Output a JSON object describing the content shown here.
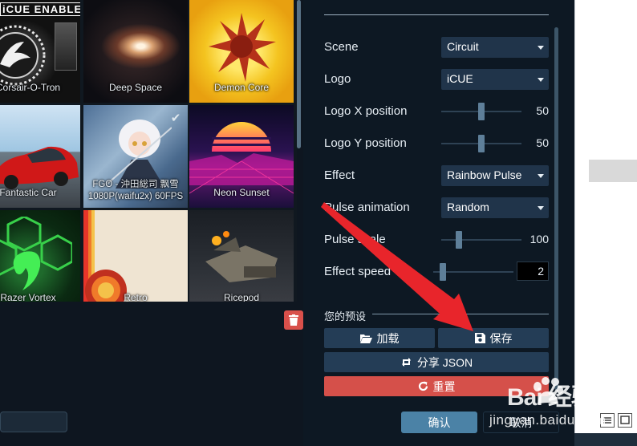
{
  "wallpapers": [
    {
      "label": "Corsair-O-Tron",
      "badge": "iCUE ENABLED"
    },
    {
      "label": "Deep Space"
    },
    {
      "label": "Demon Core"
    },
    {
      "label": "Fantastic Car"
    },
    {
      "label_line1": "FGO - 沖田総司 飘雪",
      "label_line2": "1080P(waifu2x) 60FPS",
      "selected": true
    },
    {
      "label": "Neon Sunset"
    },
    {
      "label": "Razer Vortex"
    },
    {
      "label": "Retro"
    },
    {
      "label": "Ricepod"
    }
  ],
  "settings": {
    "scene": {
      "label": "Scene",
      "value": "Circuit"
    },
    "logo": {
      "label": "Logo",
      "value": "iCUE"
    },
    "logo_x": {
      "label": "Logo X position",
      "value": "50"
    },
    "logo_y": {
      "label": "Logo Y position",
      "value": "50"
    },
    "effect": {
      "label": "Effect",
      "value": "Rainbow Pulse"
    },
    "pulse_animation": {
      "label": "Pulse animation",
      "value": "Random"
    },
    "pulse_scale": {
      "label": "Pulse scale",
      "value": "100"
    },
    "effect_speed": {
      "label": "Effect speed",
      "value": "2"
    }
  },
  "presets": {
    "title": "您的预设",
    "load_label": "加载",
    "save_label": "保存",
    "share_label": "分享 JSON",
    "reset_label": "重置"
  },
  "footer": {
    "confirm_label": "确认",
    "cancel_label": "取消"
  },
  "watermark": {
    "text": "Bai 经验",
    "sub": "jingyan.baidu.com"
  },
  "colors": {
    "panel_bg": "#0d1823",
    "select_bg": "#20344a",
    "button_bg": "#243d56",
    "danger": "#d5504a",
    "accent": "#4b82a6",
    "arrow": "#e8252b"
  }
}
